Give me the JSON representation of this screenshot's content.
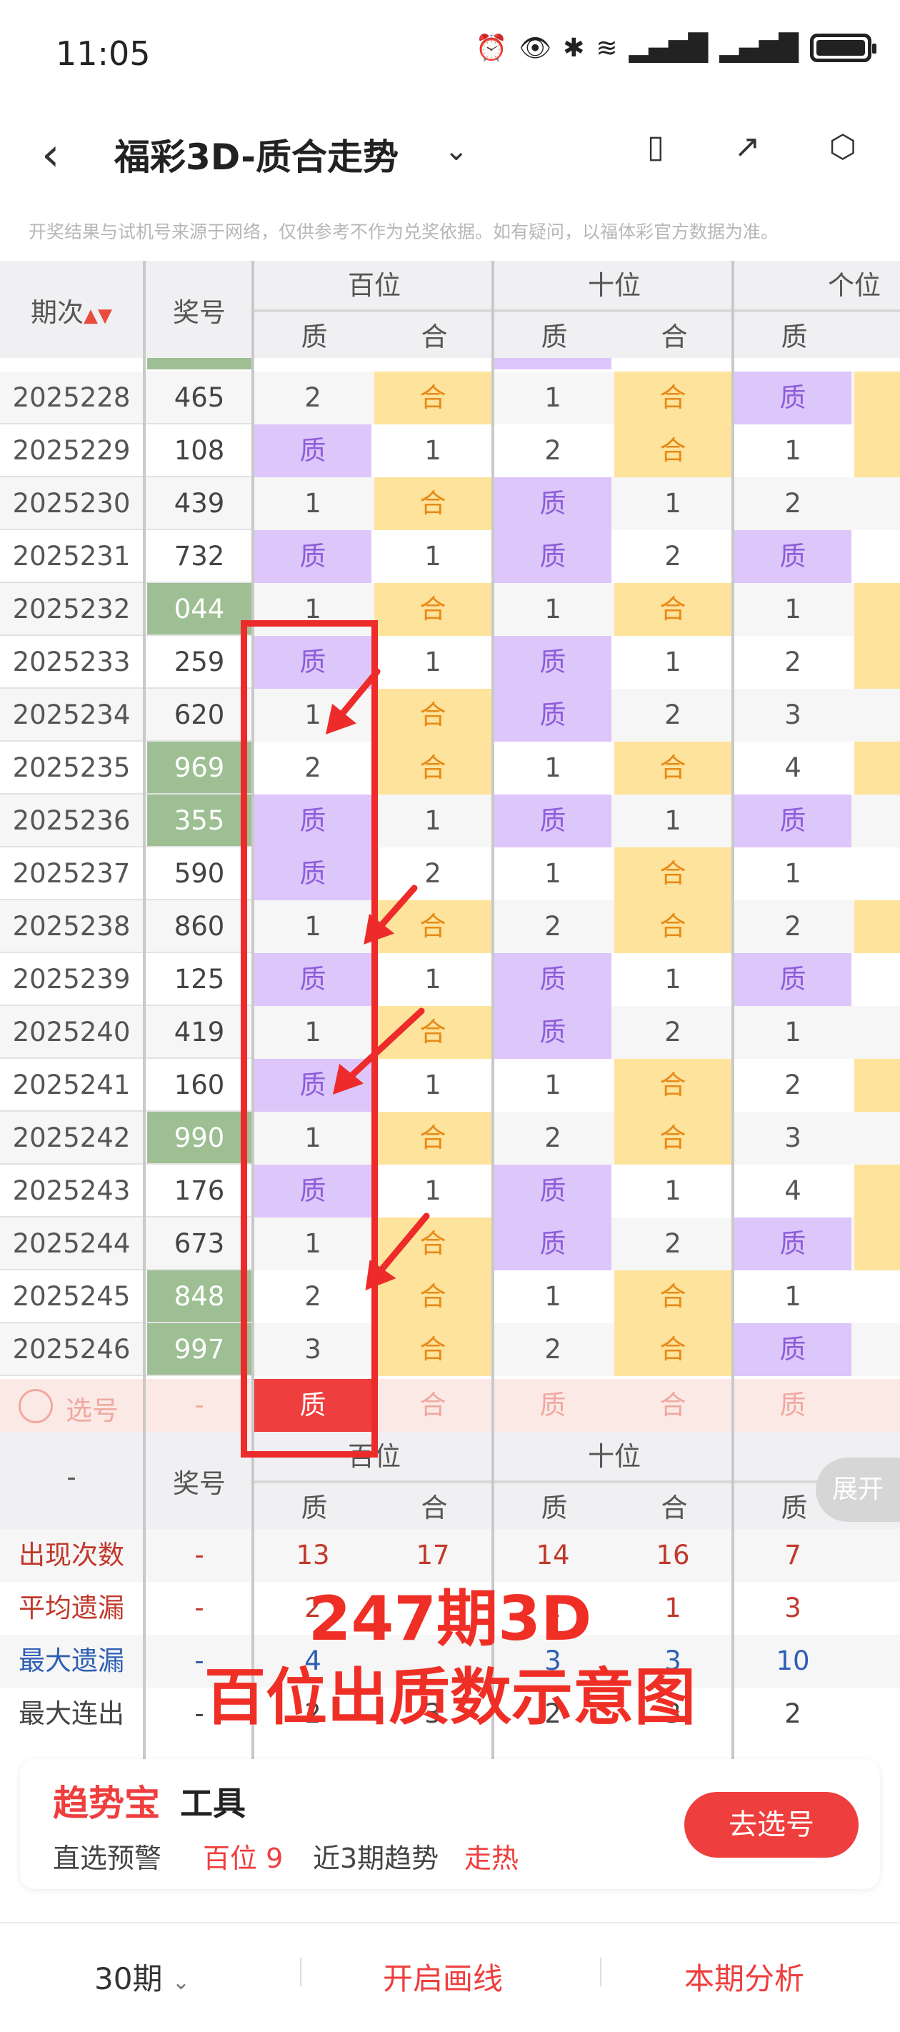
{
  "status_bar": {
    "time": "11:05"
  },
  "nav": {
    "title": "福彩3D-质合走势"
  },
  "notice": "开奖结果与试机号来源于网络，仅供参考不作为兑奖依据。如有疑问，以福体彩官方数据为准。",
  "table_header": {
    "period": "期次",
    "number": "奖号",
    "groups": [
      "百位",
      "十位",
      "个位"
    ],
    "sub": [
      "质",
      "合",
      "质",
      "合",
      "质"
    ]
  },
  "rows": [
    {
      "period": "2025228",
      "number": "465",
      "hi": false,
      "cells": [
        "2",
        "合",
        "1",
        "合",
        "质"
      ]
    },
    {
      "period": "2025229",
      "number": "108",
      "hi": false,
      "cells": [
        "质",
        "1",
        "2",
        "合",
        "1"
      ]
    },
    {
      "period": "2025230",
      "number": "439",
      "hi": false,
      "cells": [
        "1",
        "合",
        "质",
        "1",
        "2"
      ]
    },
    {
      "period": "2025231",
      "number": "732",
      "hi": false,
      "cells": [
        "质",
        "1",
        "质",
        "2",
        "质"
      ]
    },
    {
      "period": "2025232",
      "number": "044",
      "hi": true,
      "cells": [
        "1",
        "合",
        "1",
        "合",
        "1"
      ]
    },
    {
      "period": "2025233",
      "number": "259",
      "hi": false,
      "cells": [
        "质",
        "1",
        "质",
        "1",
        "2"
      ]
    },
    {
      "period": "2025234",
      "number": "620",
      "hi": false,
      "cells": [
        "1",
        "合",
        "质",
        "2",
        "3"
      ]
    },
    {
      "period": "2025235",
      "number": "969",
      "hi": true,
      "cells": [
        "2",
        "合",
        "1",
        "合",
        "4"
      ]
    },
    {
      "period": "2025236",
      "number": "355",
      "hi": true,
      "cells": [
        "质",
        "1",
        "质",
        "1",
        "质"
      ]
    },
    {
      "period": "2025237",
      "number": "590",
      "hi": false,
      "cells": [
        "质",
        "2",
        "1",
        "合",
        "1"
      ]
    },
    {
      "period": "2025238",
      "number": "860",
      "hi": false,
      "cells": [
        "1",
        "合",
        "2",
        "合",
        "2"
      ]
    },
    {
      "period": "2025239",
      "number": "125",
      "hi": false,
      "cells": [
        "质",
        "1",
        "质",
        "1",
        "质"
      ]
    },
    {
      "period": "2025240",
      "number": "419",
      "hi": false,
      "cells": [
        "1",
        "合",
        "质",
        "2",
        "1"
      ]
    },
    {
      "period": "2025241",
      "number": "160",
      "hi": false,
      "cells": [
        "质",
        "1",
        "1",
        "合",
        "2"
      ]
    },
    {
      "period": "2025242",
      "number": "990",
      "hi": true,
      "cells": [
        "1",
        "合",
        "2",
        "合",
        "3"
      ]
    },
    {
      "period": "2025243",
      "number": "176",
      "hi": false,
      "cells": [
        "质",
        "1",
        "质",
        "1",
        "4"
      ]
    },
    {
      "period": "2025244",
      "number": "673",
      "hi": false,
      "cells": [
        "1",
        "合",
        "质",
        "2",
        "质"
      ]
    },
    {
      "period": "2025245",
      "number": "848",
      "hi": true,
      "cells": [
        "2",
        "合",
        "1",
        "合",
        "1"
      ]
    },
    {
      "period": "2025246",
      "number": "997",
      "hi": true,
      "cells": [
        "3",
        "合",
        "2",
        "合",
        "质"
      ]
    }
  ],
  "pick_row": {
    "label": "选号",
    "dash": "-",
    "cells": [
      "质",
      "合",
      "质",
      "合",
      "质"
    ]
  },
  "stats_header": {
    "dash": "-",
    "number": "奖号",
    "groups": [
      "百位",
      "十位"
    ],
    "expand": "展开",
    "sub": [
      "质",
      "合",
      "质",
      "合",
      "质"
    ]
  },
  "stats": [
    {
      "label": "出现次数",
      "dash": "-",
      "values": [
        "13",
        "17",
        "14",
        "16",
        "7"
      ],
      "color": "#c0392b"
    },
    {
      "label": "平均遗漏",
      "dash": "-",
      "values": [
        "2",
        "",
        "1",
        "1",
        "3"
      ],
      "color": "#c0392b"
    },
    {
      "label": "最大遗漏",
      "dash": "-",
      "values": [
        "4",
        "",
        "3",
        "3",
        "10"
      ],
      "color": "#2f5fb3"
    },
    {
      "label": "最大连出",
      "dash": "-",
      "values": [
        "2",
        "3",
        "2",
        "3",
        "2"
      ],
      "color": "#444"
    }
  ],
  "overlay": {
    "line1": "247期3D",
    "line2": "百位出质数示意图"
  },
  "tool": {
    "brand": "趋势宝",
    "suffix": "工具",
    "warn_label": "直选预警",
    "warn_pos": "百位 9",
    "trend_label": "近3期趋势",
    "trend_value": "走热",
    "button": "去选号"
  },
  "bottom": {
    "periods": "30期",
    "draw": "开启画线",
    "analysis": "本期分析"
  },
  "colors": {
    "accent": "#ef3e3e",
    "prime_bg": "#dcc6fa",
    "composite_bg": "#fde39c",
    "highlight_number_bg": "#9dbf93"
  }
}
